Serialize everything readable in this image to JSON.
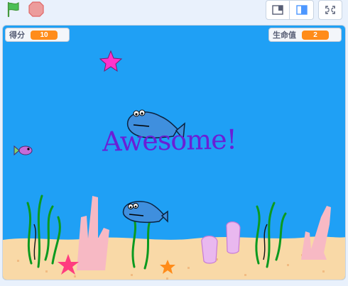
{
  "toolbar": {
    "green_flag_icon": "green-flag-icon",
    "stop_icon": "stop-sign-icon",
    "small_stage_icon": "small-stage-icon",
    "normal_stage_icon": "normal-stage-icon",
    "fullscreen_icon": "fullscreen-icon"
  },
  "monitors": {
    "score": {
      "label": "得分",
      "value": "10"
    },
    "lives": {
      "label": "生命值",
      "value": "2"
    }
  },
  "stage": {
    "message": "Awesome!",
    "colors": {
      "water": "#1fa0f5",
      "sand": "#f9d9a7",
      "monitor_value": "#ff8c1a",
      "text": "#6a1fd6"
    }
  }
}
